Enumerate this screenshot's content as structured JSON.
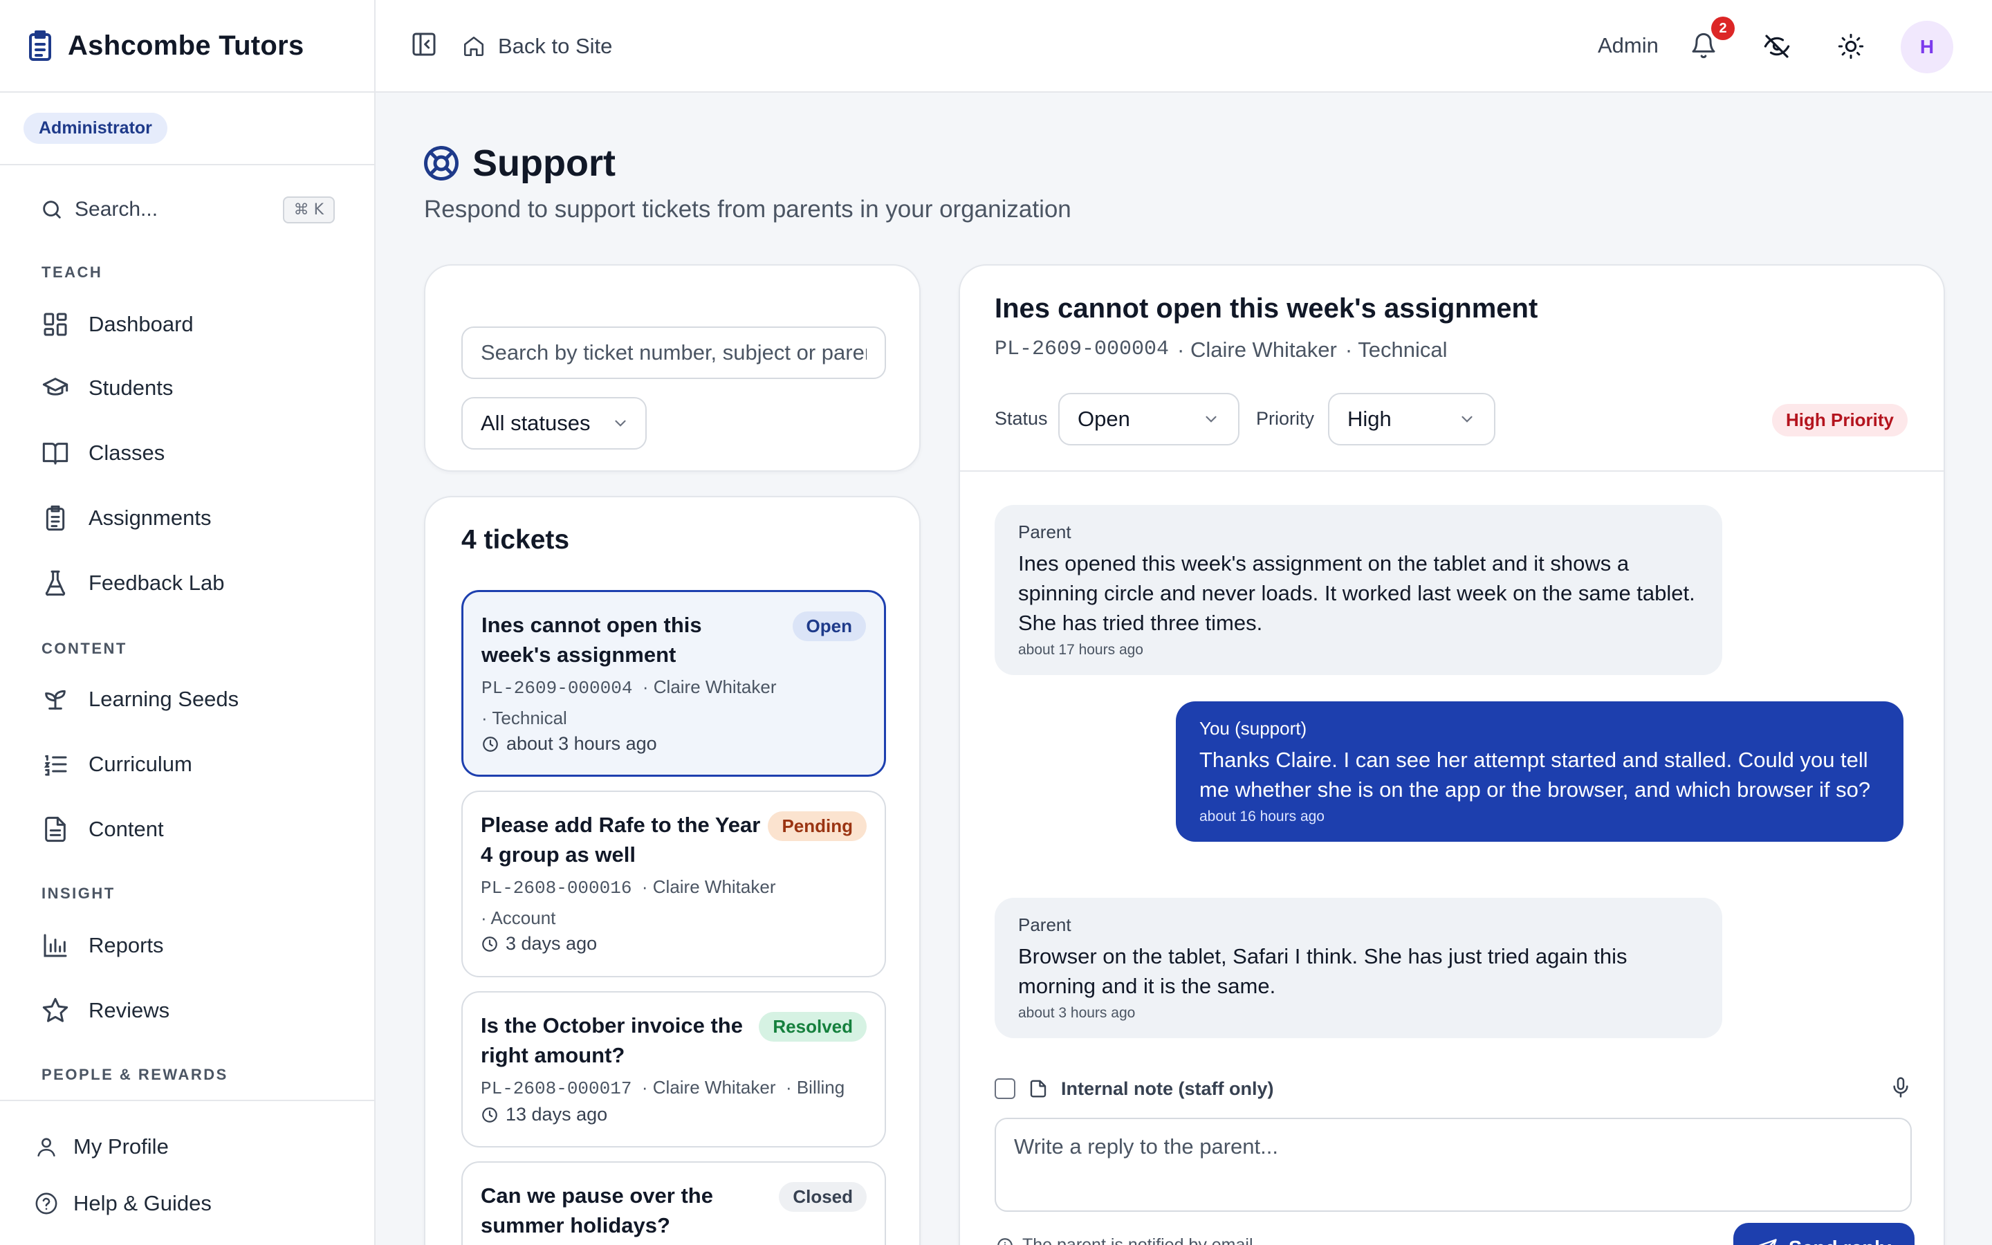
{
  "app": {
    "name": "Ashcombe Tutors",
    "role": "Administrator"
  },
  "sidebar": {
    "search_label": "Search...",
    "search_shortcut": "⌘ K",
    "sections": {
      "teach": "TEACH",
      "content": "CONTENT",
      "insight": "INSIGHT",
      "people": "PEOPLE & REWARDS"
    },
    "items": [
      {
        "label": "Dashboard",
        "icon": "dashboard-icon"
      },
      {
        "label": "Students",
        "icon": "graduation-cap-icon"
      },
      {
        "label": "Classes",
        "icon": "book-icon"
      },
      {
        "label": "Assignments",
        "icon": "clipboard-icon"
      },
      {
        "label": "Feedback Lab",
        "icon": "flask-icon"
      },
      {
        "label": "Learning Seeds",
        "icon": "sprout-icon"
      },
      {
        "label": "Curriculum",
        "icon": "list-ordered-icon"
      },
      {
        "label": "Content",
        "icon": "file-icon"
      },
      {
        "label": "Reports",
        "icon": "bar-chart-icon"
      },
      {
        "label": "Reviews",
        "icon": "star-icon"
      }
    ],
    "bottom": [
      {
        "label": "My Profile",
        "icon": "user-icon"
      },
      {
        "label": "Help & Guides",
        "icon": "help-circle-icon"
      }
    ]
  },
  "topbar": {
    "back_label": "Back to Site",
    "user_label": "Admin",
    "notification_count": "2",
    "avatar_initial": "H"
  },
  "page": {
    "title": "Support",
    "subtitle": "Respond to support tickets from parents in your organization"
  },
  "filters": {
    "search_placeholder": "Search by ticket number, subject or parent",
    "status_value": "All statuses"
  },
  "tickets": {
    "count_label": "4 tickets",
    "items": [
      {
        "title": "Ines cannot open this week's assignment",
        "status": "Open",
        "number": "PL-2609-000004",
        "parent": "· Claire Whitaker",
        "category": "· Technical",
        "time": "about 3 hours ago"
      },
      {
        "title": "Please add Rafe to the Year 4 group as well",
        "status": "Pending",
        "number": "PL-2608-000016",
        "parent": "· Claire Whitaker",
        "category": "· Account",
        "time": "3 days ago"
      },
      {
        "title": "Is the October invoice the right amount?",
        "status": "Resolved",
        "number": "PL-2608-000017",
        "parent": "· Claire Whitaker",
        "category": "· Billing",
        "time": "13 days ago"
      },
      {
        "title": "Can we pause over the summer holidays?",
        "status": "Closed"
      }
    ]
  },
  "detail": {
    "title": "Ines cannot open this week's assignment",
    "number": "PL-2609-000004",
    "parent": "· Claire Whitaker",
    "category": "· Technical",
    "status_label": "Status",
    "status_value": "Open",
    "priority_label": "Priority",
    "priority_value": "High",
    "priority_badge": "High Priority",
    "messages": [
      {
        "author": "Parent",
        "body": "Ines opened this week's assignment on the tablet and it shows a spinning circle and never loads. It worked last week on the same tablet. She has tried three times.",
        "time": "about 17 hours ago"
      },
      {
        "author": "You (support)",
        "body": "Thanks Claire. I can see her attempt started and stalled. Could you tell me whether she is on the app or the browser, and which browser if so?",
        "time": "about 16 hours ago"
      },
      {
        "author": "Parent",
        "body": "Browser on the tablet, Safari I think. She has just tried again this morning and it is the same.",
        "time": "about 3 hours ago"
      }
    ],
    "internal_note_label": "Internal note (staff only)",
    "reply_placeholder": "Write a reply to the parent...",
    "send_label": "Send reply",
    "footer_hint": "The parent is notified by email"
  }
}
